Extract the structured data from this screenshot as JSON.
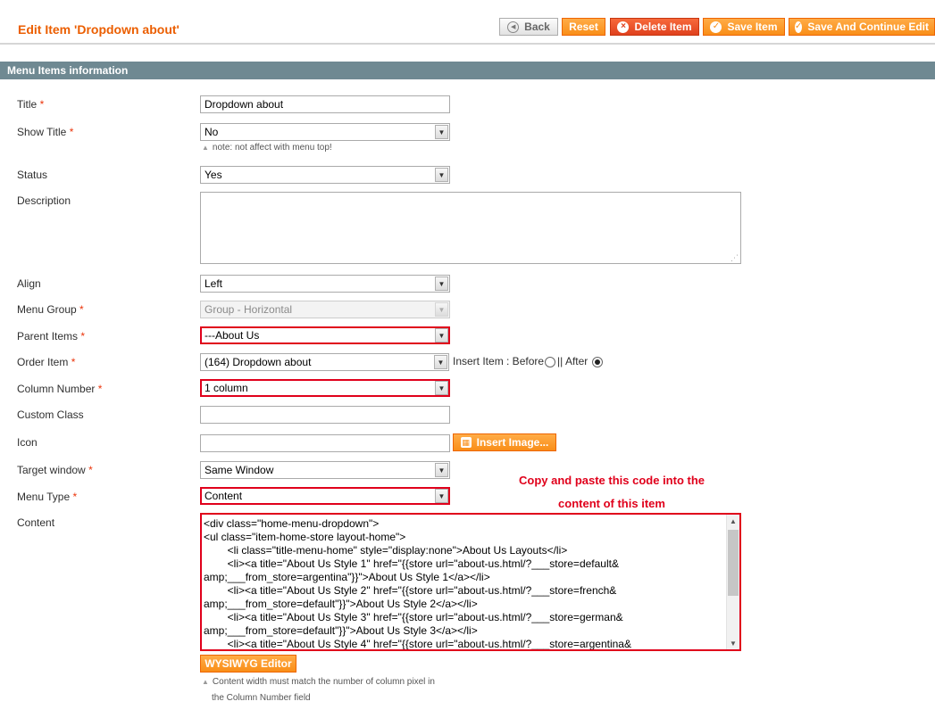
{
  "header": {
    "title": "Edit Item 'Dropdown about'",
    "buttons": {
      "back": "Back",
      "reset": "Reset",
      "delete": "Delete Item",
      "save": "Save Item",
      "save_continue": "Save And Continue Edit"
    }
  },
  "section": {
    "title": "Menu Items information"
  },
  "form": {
    "title": {
      "label": "Title",
      "value": "Dropdown about"
    },
    "show_title": {
      "label": "Show Title",
      "value": "No",
      "note": "note: not affect with menu top!"
    },
    "status": {
      "label": "Status",
      "value": "Yes"
    },
    "description": {
      "label": "Description",
      "value": ""
    },
    "align": {
      "label": "Align",
      "value": "Left"
    },
    "menu_group": {
      "label": "Menu Group",
      "value": "Group - Horizontal"
    },
    "parent_items": {
      "label": "Parent Items",
      "value": "---About Us"
    },
    "order_item": {
      "label": "Order Item",
      "value": "(164) Dropdown about",
      "insert_label": "Insert Item : Before",
      "separator": "|| After",
      "selected": "After"
    },
    "column_number": {
      "label": "Column Number",
      "value": "1 column"
    },
    "custom_class": {
      "label": "Custom Class",
      "value": ""
    },
    "icon": {
      "label": "Icon",
      "value": "",
      "button": "Insert Image..."
    },
    "target_window": {
      "label": "Target window",
      "value": "Same Window"
    },
    "menu_type": {
      "label": "Menu Type",
      "value": "Content"
    },
    "content": {
      "label": "Content",
      "code": "<div class=\"home-menu-dropdown\">\n<ul class=\"item-home-store layout-home\">\n\t\t<li class=\"title-menu-home\" style=\"display:none\">About Us Layouts</li>\n\t\t<li><a title=\"About Us Style 1\" href=\"{{store url=\"about-us.html/?___store=default&\namp;___from_store=argentina\"}}\">About Us Style 1</a></li>\n\t\t<li><a title=\"About Us Style 2\" href=\"{{store url=\"about-us.html/?___store=french&\namp;___from_store=default\"}}\">About Us Style 2</a></li>\n\t\t<li><a title=\"About Us Style 3\" href=\"{{store url=\"about-us.html/?___store=german&\namp;___from_store=default\"}}\">About Us Style 3</a></li>\n\t\t<li><a title=\"About Us Style 4\" href=\"{{store url=\"about-us.html/?___store=argentina&",
      "wysiwyg_button": "WYSIWYG Editor",
      "note_line1": "Content width must match the number of column pixel in",
      "note_line2": "the Column Number field"
    },
    "required_mark": "*"
  },
  "annotation": {
    "line1": "Copy and paste this code into the",
    "line2": "content of this item"
  },
  "colors": {
    "accent": "#eb5e00",
    "button": "#f98e18",
    "delete": "#e0411e",
    "section": "#6f8992",
    "highlight": "#e0001b"
  }
}
